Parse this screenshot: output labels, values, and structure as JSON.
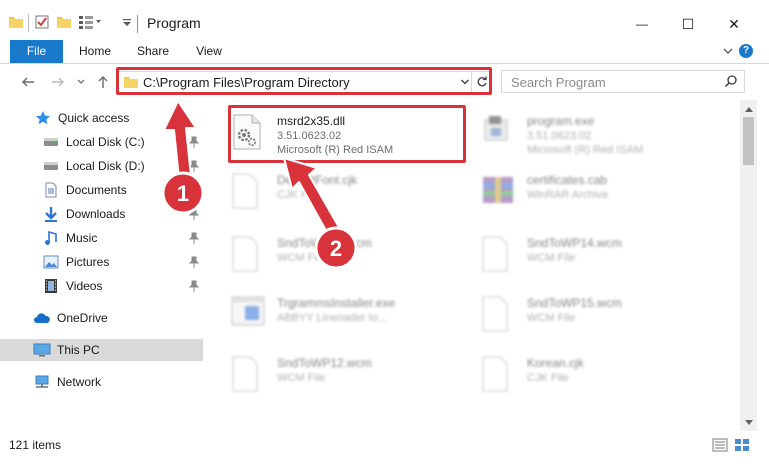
{
  "window": {
    "title": "Program",
    "minimize_glyph": "—",
    "maximize_glyph": "☐",
    "close_glyph": "✕"
  },
  "ribbon": {
    "tabs": [
      "File",
      "Home",
      "Share",
      "View"
    ],
    "help_glyph": "?"
  },
  "address": {
    "path": "C:\\Program Files\\Program Directory",
    "search_placeholder": "Search Program"
  },
  "sidebar": {
    "items": [
      {
        "label": "Quick access",
        "icon": "star-icon",
        "pinned": false
      },
      {
        "label": "Local Disk (C:)",
        "icon": "drive-icon",
        "pinned": true
      },
      {
        "label": "Local Disk (D:)",
        "icon": "drive-icon",
        "pinned": true
      },
      {
        "label": "Documents",
        "icon": "documents-icon",
        "pinned": true
      },
      {
        "label": "Downloads",
        "icon": "download-icon",
        "pinned": true
      },
      {
        "label": "Music",
        "icon": "music-icon",
        "pinned": true
      },
      {
        "label": "Pictures",
        "icon": "pictures-icon",
        "pinned": true
      },
      {
        "label": "Videos",
        "icon": "videos-icon",
        "pinned": true
      },
      {
        "label": "OneDrive",
        "icon": "cloud-icon",
        "pinned": false
      },
      {
        "label": "This PC",
        "icon": "computer-icon",
        "pinned": false,
        "selected": true
      },
      {
        "label": "Network",
        "icon": "network-icon",
        "pinned": false
      }
    ]
  },
  "files": {
    "left": [
      {
        "name": "msrd2x35.dll",
        "line1": "3.51.0623.02",
        "line2": "Microsoft (R) Red ISAM",
        "icon": "dll-gear-icon",
        "highlighted": true
      },
      {
        "name": "DefaultFont.cjk",
        "line1": "CJK File",
        "icon": "blank-file-icon"
      },
      {
        "name": "SndToWP12.wcm",
        "line1": "WCM File",
        "icon": "blank-file-icon"
      },
      {
        "name": "TrgrammsInstaller.exe",
        "line1": "ABBYY Lineoader to...",
        "icon": "installer-icon"
      },
      {
        "name": "SndToWP12.wcm",
        "line1": "WCM File",
        "icon": "blank-file-icon"
      }
    ],
    "right": [
      {
        "name": "program.exe",
        "line1": "3.51.0623.02",
        "line2": "Microsoft (R) Red ISAM",
        "icon": "exe-icon"
      },
      {
        "name": "certificates.cab",
        "line1": "WinRAR Archive",
        "icon": "archive-icon"
      },
      {
        "name": "SndToWP14.wcm",
        "line1": "WCM File",
        "icon": "blank-file-icon"
      },
      {
        "name": "SndToWP15.wcm",
        "line1": "WCM File",
        "icon": "blank-file-icon"
      },
      {
        "name": "Korean.cjk",
        "line1": "CJK File",
        "icon": "blank-file-icon"
      }
    ]
  },
  "status": {
    "item_count": "121 items"
  },
  "annotations": {
    "step1": "1",
    "step2": "2"
  },
  "colors": {
    "accent": "#1979ca",
    "highlight_box": "#d8323a",
    "selected_nav": "#d9d9d9"
  }
}
